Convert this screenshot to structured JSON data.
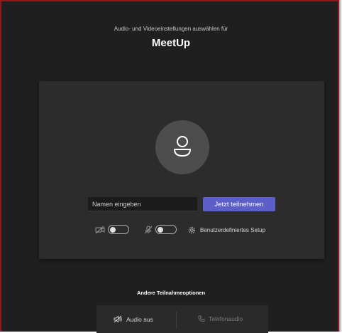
{
  "header": {
    "subtitle": "Audio- und Videoeinstellungen auswählen für",
    "meeting_title": "MeetUp"
  },
  "join": {
    "name_placeholder": "Namen eingeben",
    "join_button_label": "Jetzt teilnehmen"
  },
  "controls": {
    "camera_icon": "camera-off-icon",
    "camera_toggle_on": false,
    "mic_icon": "mic-off-icon",
    "mic_toggle_on": false,
    "setup_icon": "gear-icon",
    "setup_label": "Benutzerdefiniertes Setup"
  },
  "other_options": {
    "label": "Andere Teilnahmeoptionen",
    "audio_off_label": "Audio aus",
    "phone_audio_label": "Telefonaudio"
  },
  "colors": {
    "background": "#1f1f1f",
    "panel": "#2d2c2c",
    "accent": "#5b5fc7",
    "frame_border": "#8b1a1a"
  }
}
